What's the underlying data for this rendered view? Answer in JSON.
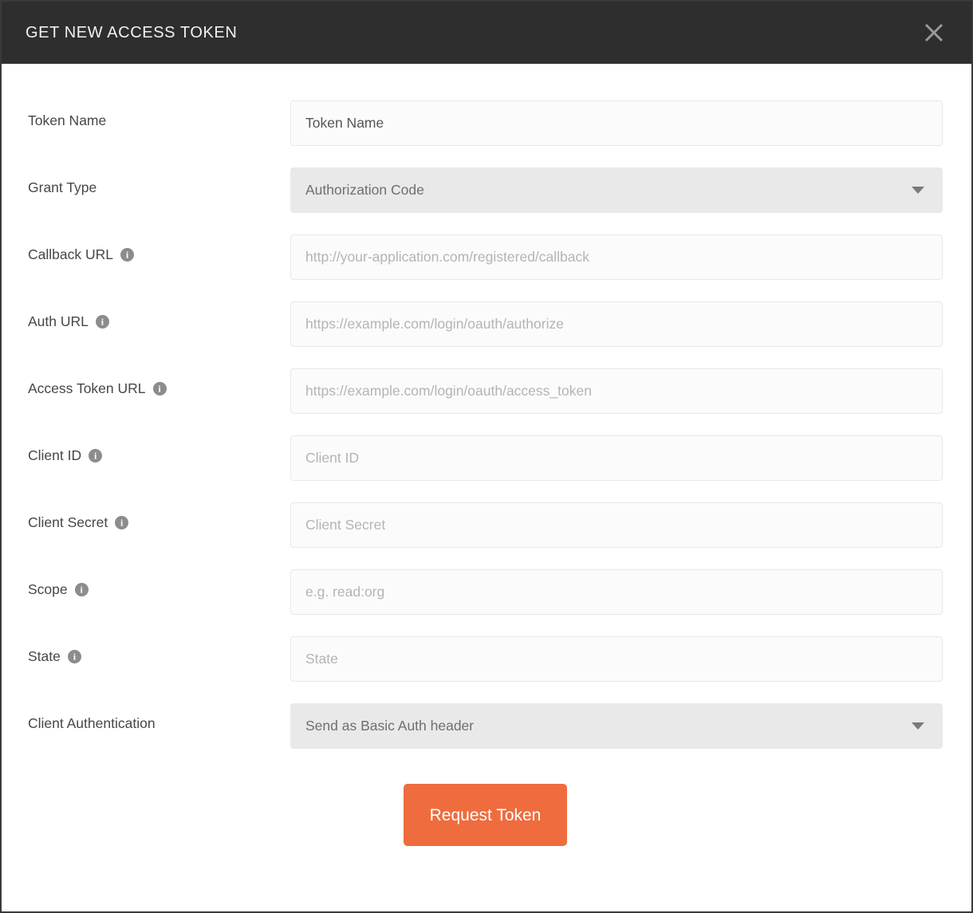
{
  "header": {
    "title": "GET NEW ACCESS TOKEN",
    "close_icon": "close-icon"
  },
  "colors": {
    "header_bg": "#2e2e2e",
    "accent_button": "#ef6c3e",
    "input_bg": "#fbfbfb",
    "select_bg": "#e9e9e9",
    "label_text": "#474747",
    "placeholder_text": "#b4b4b4",
    "info_icon": "#8c8c8c"
  },
  "form": {
    "fields": [
      {
        "label": "Token Name",
        "type": "text",
        "value": "Token Name",
        "placeholder": "Token Name",
        "has_info": false
      },
      {
        "label": "Grant Type",
        "type": "select",
        "value": "Authorization Code",
        "has_info": false
      },
      {
        "label": "Callback URL",
        "type": "text",
        "value": "",
        "placeholder": "http://your-application.com/registered/callback",
        "has_info": true
      },
      {
        "label": "Auth URL",
        "type": "text",
        "value": "",
        "placeholder": "https://example.com/login/oauth/authorize",
        "has_info": true
      },
      {
        "label": "Access Token URL",
        "type": "text",
        "value": "",
        "placeholder": "https://example.com/login/oauth/access_token",
        "has_info": true
      },
      {
        "label": "Client ID",
        "type": "text",
        "value": "",
        "placeholder": "Client ID",
        "has_info": true
      },
      {
        "label": "Client Secret",
        "type": "text",
        "value": "",
        "placeholder": "Client Secret",
        "has_info": true
      },
      {
        "label": "Scope",
        "type": "text",
        "value": "",
        "placeholder": "e.g. read:org",
        "has_info": true
      },
      {
        "label": "State",
        "type": "text",
        "value": "",
        "placeholder": "State",
        "has_info": true
      },
      {
        "label": "Client Authentication",
        "type": "select",
        "value": "Send as Basic Auth header",
        "has_info": false
      }
    ]
  },
  "actions": {
    "request_token_label": "Request Token"
  },
  "info_glyph": "i"
}
